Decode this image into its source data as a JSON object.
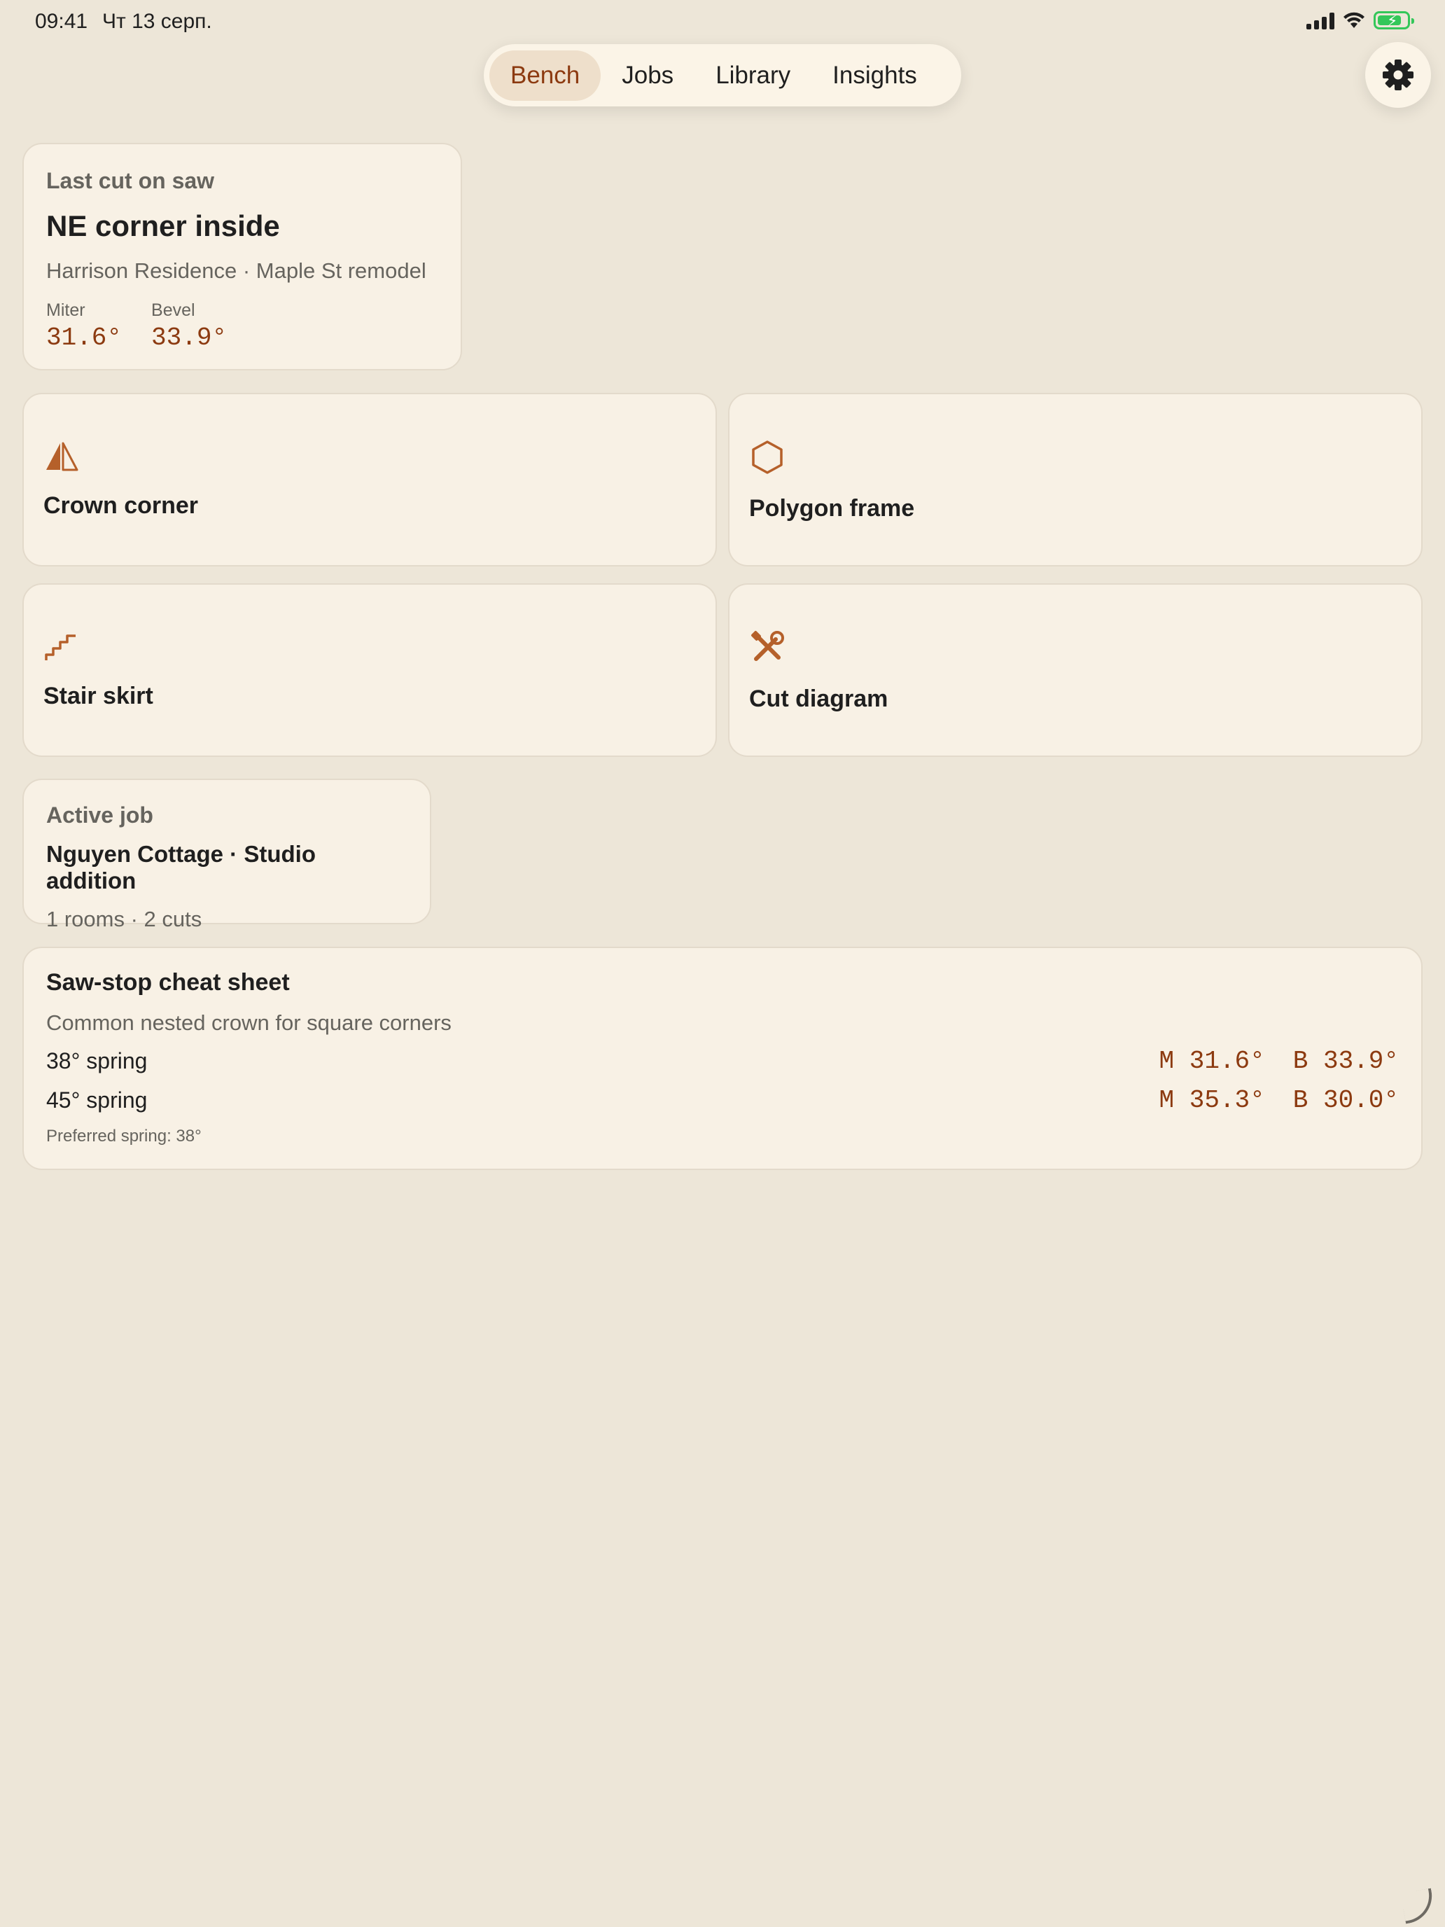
{
  "status_bar": {
    "time": "09:41",
    "date": "Чт 13 серп.",
    "battery_color": "#34C759"
  },
  "tabs": [
    {
      "label": "Bench",
      "active": true
    },
    {
      "label": "Jobs",
      "active": false
    },
    {
      "label": "Library",
      "active": false
    },
    {
      "label": "Insights",
      "active": false
    }
  ],
  "settings": {
    "icon": "gear-icon"
  },
  "last_cut": {
    "eyebrow": "Last cut on saw",
    "title": "NE corner inside",
    "subtitle": "Harrison Residence · Maple St remodel",
    "miter_label": "Miter",
    "miter_value": "31.6°",
    "bevel_label": "Bevel",
    "bevel_value": "33.9°"
  },
  "tools": [
    {
      "label": "Crown corner",
      "icon": "crown-corner-icon"
    },
    {
      "label": "Polygon frame",
      "icon": "hexagon-icon"
    },
    {
      "label": "Stair skirt",
      "icon": "stairs-icon"
    },
    {
      "label": "Cut diagram",
      "icon": "tools-icon"
    }
  ],
  "active_job": {
    "eyebrow": "Active job",
    "title": "Nguyen Cottage · Studio addition",
    "subtitle": "1 rooms · 2 cuts"
  },
  "cheat_sheet": {
    "title": "Saw-stop cheat sheet",
    "subtitle": "Common nested crown for square corners",
    "rows": [
      {
        "name": "38° spring",
        "miter": "M 31.6°",
        "bevel": "B 33.9°"
      },
      {
        "name": "45° spring",
        "miter": "M 35.3°",
        "bevel": "B 30.0°"
      }
    ],
    "footnote": "Preferred spring: 38°"
  },
  "colors": {
    "background": "#EDE6D8",
    "card": "#F8F1E5",
    "accent": "#8C3A10",
    "icon_accent": "#B5602A"
  }
}
